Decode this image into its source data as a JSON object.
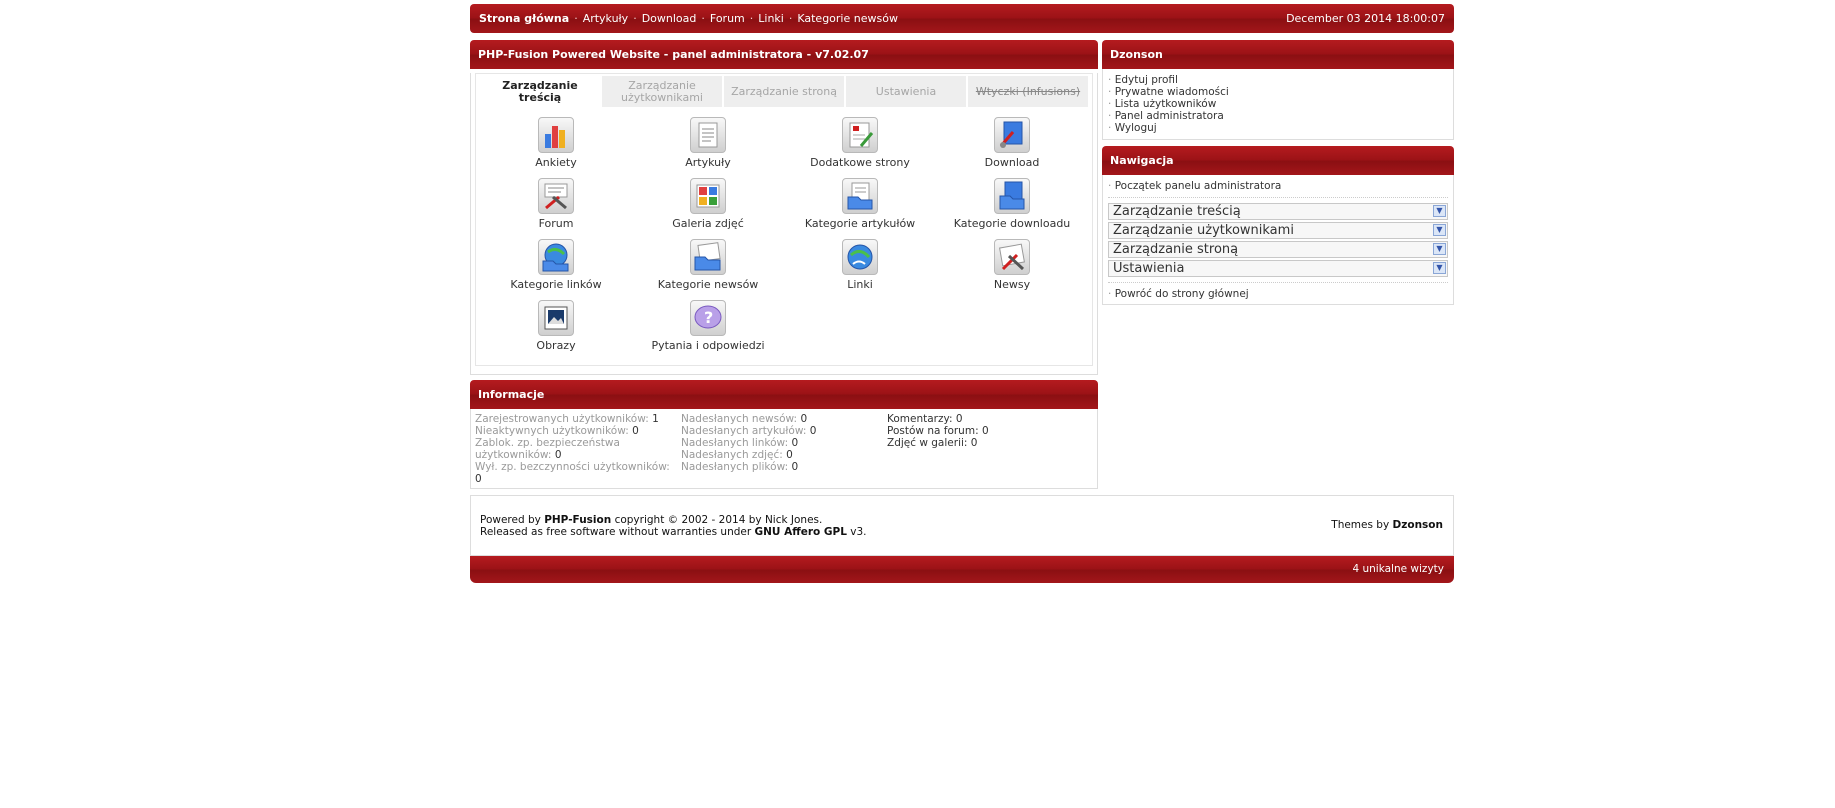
{
  "topnav": {
    "links": [
      "Strona główna",
      "Artykuły",
      "Download",
      "Forum",
      "Linki",
      "Kategorie newsów"
    ],
    "datetime": "December 03 2014 18:00:07"
  },
  "admin": {
    "title": "PHP-Fusion Powered Website - panel administratora - v7.02.07",
    "tabs": [
      "Zarządzanie treścią",
      "Zarządzanie użytkownikami",
      "Zarządzanie stroną",
      "Ustawienia",
      "Wtyczki (Infusions)"
    ],
    "icons": [
      {
        "label": "Ankiety",
        "icon": "polls-icon"
      },
      {
        "label": "Artykuły",
        "icon": "articles-icon"
      },
      {
        "label": "Dodatkowe strony",
        "icon": "custom-pages-icon"
      },
      {
        "label": "Download",
        "icon": "download-icon"
      },
      {
        "label": "Forum",
        "icon": "forum-icon"
      },
      {
        "label": "Galeria zdjęć",
        "icon": "photo-gallery-icon"
      },
      {
        "label": "Kategorie artykułów",
        "icon": "article-categories-icon"
      },
      {
        "label": "Kategorie downloadu",
        "icon": "download-categories-icon"
      },
      {
        "label": "Kategorie linków",
        "icon": "link-categories-icon"
      },
      {
        "label": "Kategorie newsów",
        "icon": "news-categories-icon"
      },
      {
        "label": "Linki",
        "icon": "links-icon"
      },
      {
        "label": "Newsy",
        "icon": "news-icon"
      },
      {
        "label": "Obrazy",
        "icon": "images-icon"
      },
      {
        "label": "Pytania i odpowiedzi",
        "icon": "faq-icon"
      }
    ]
  },
  "info": {
    "title": "Informacje",
    "col1": {
      "registered_label": "Zarejestrowanych użytkowników:",
      "registered": "1",
      "inactive_label": "Nieaktywnych użytkowników:",
      "inactive": "0",
      "blocked_label_1": "Zablok. zp. bezpieczeństwa",
      "blocked_label_2": "użytkowników:",
      "blocked": "0",
      "idle_label": "Wył. zp. bezczynności użytkowników:",
      "idle": "0"
    },
    "col2": {
      "news_label": "Nadesłanych newsów:",
      "news": "0",
      "articles_label": "Nadesłanych artykułów:",
      "articles": "0",
      "links_label": "Nadesłanych linków:",
      "links": "0",
      "photos_label": "Nadesłanych zdjęć:",
      "photos": "0",
      "files_label": "Nadesłanych plików:",
      "files": "0"
    },
    "col3": {
      "comments_label": "Komentarzy:",
      "comments": "0",
      "forum_label": "Postów na forum:",
      "forum": "0",
      "gallery_label": "Zdjęć w galerii:",
      "gallery": "0"
    }
  },
  "user_panel": {
    "title": "Dzonson",
    "items": [
      "Edytuj profil",
      "Prywatne wiadomości",
      "Lista użytkowników",
      "Panel administratora",
      "Wyloguj"
    ]
  },
  "nav_panel": {
    "title": "Nawigacja",
    "start": "Początek panelu administratora",
    "selects": [
      "Zarządzanie treścią",
      "Zarządzanie użytkownikami",
      "Zarządzanie stroną",
      "Ustawienia"
    ],
    "back": "Powróć do strony głównej"
  },
  "footer": {
    "powered_prefix": "Powered by",
    "powered_name": "PHP-Fusion",
    "powered_rest": "copyright © 2002 - 2014 by Nick Jones.",
    "released_prefix": "Released as free software without warranties under",
    "license": "GNU Affero GPL",
    "released_suffix": "v3.",
    "themes_prefix": "Themes by",
    "themes_name": "Dzonson",
    "visits": "4 unikalne wizyty"
  },
  "colors": {
    "accent": "#9a1216"
  }
}
